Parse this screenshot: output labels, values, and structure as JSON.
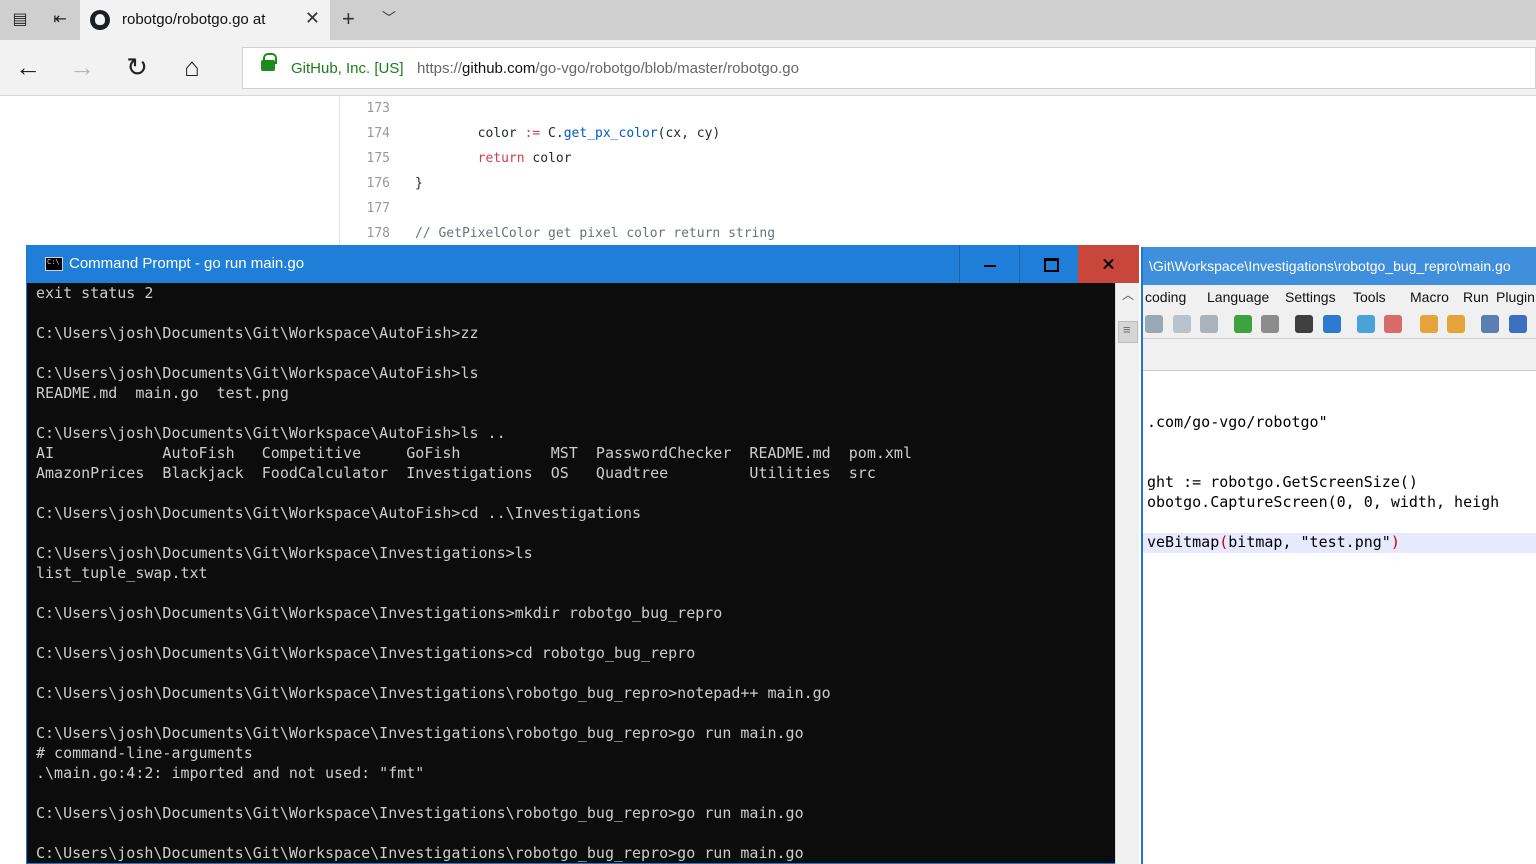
{
  "browser": {
    "tab": {
      "title": "robotgo/robotgo.go at"
    },
    "address": {
      "cert": "GitHub, Inc. [US]",
      "url_scheme": "https://",
      "url_host": "github.com",
      "url_path": "/go-vgo/robotgo/blob/master/robotgo.go"
    }
  },
  "github_code": {
    "lines": [
      {
        "num": "173",
        "parts": []
      },
      {
        "num": "174",
        "parts": [
          {
            "t": "        color ",
            "c": ""
          },
          {
            "t": ":=",
            "c": "kw"
          },
          {
            "t": " C.",
            "c": ""
          },
          {
            "t": "get_px_color",
            "c": "fn"
          },
          {
            "t": "(cx, cy)",
            "c": ""
          }
        ]
      },
      {
        "num": "175",
        "parts": [
          {
            "t": "        ",
            "c": ""
          },
          {
            "t": "return",
            "c": "kw"
          },
          {
            "t": " color",
            "c": ""
          }
        ]
      },
      {
        "num": "176",
        "parts": [
          {
            "t": "}",
            "c": ""
          }
        ]
      },
      {
        "num": "177",
        "parts": []
      },
      {
        "num": "178",
        "parts": [
          {
            "t": "// GetPixelColor get pixel color return string",
            "c": "cm"
          }
        ]
      }
    ]
  },
  "notepadpp": {
    "title": "\\Git\\Workspace\\Investigations\\robotgo_bug_repro\\main.go",
    "menu": [
      "coding",
      "Language",
      "Settings",
      "Tools",
      "Macro",
      "Run",
      "Plugin"
    ],
    "lines": [
      {
        "text": ".com/go-vgo/robotgo\"",
        "row": 0
      },
      {
        "text": "ght := robotgo.GetScreenSize()",
        "row": 3
      },
      {
        "text": "obotgo.CaptureScreen(0, 0, width, heigh",
        "row": 4
      },
      {
        "text": "veBitmap",
        "op1": "(",
        "mid": "bitmap, \"test.png\"",
        "op2": ")",
        "row": 6,
        "current": true
      }
    ]
  },
  "cmd": {
    "title": "Command Prompt - go  run main.go",
    "lines": [
      "exit status 2",
      "",
      "C:\\Users\\josh\\Documents\\Git\\Workspace\\AutoFish>zz",
      "",
      "C:\\Users\\josh\\Documents\\Git\\Workspace\\AutoFish>ls",
      "README.md  main.go  test.png",
      "",
      "C:\\Users\\josh\\Documents\\Git\\Workspace\\AutoFish>ls ..",
      "AI            AutoFish   Competitive     GoFish          MST  PasswordChecker  README.md  pom.xml",
      "AmazonPrices  Blackjack  FoodCalculator  Investigations  OS   Quadtree         Utilities  src",
      "",
      "C:\\Users\\josh\\Documents\\Git\\Workspace\\AutoFish>cd ..\\Investigations",
      "",
      "C:\\Users\\josh\\Documents\\Git\\Workspace\\Investigations>ls",
      "list_tuple_swap.txt",
      "",
      "C:\\Users\\josh\\Documents\\Git\\Workspace\\Investigations>mkdir robotgo_bug_repro",
      "",
      "C:\\Users\\josh\\Documents\\Git\\Workspace\\Investigations>cd robotgo_bug_repro",
      "",
      "C:\\Users\\josh\\Documents\\Git\\Workspace\\Investigations\\robotgo_bug_repro>notepad++ main.go",
      "",
      "C:\\Users\\josh\\Documents\\Git\\Workspace\\Investigations\\robotgo_bug_repro>go run main.go",
      "# command-line-arguments",
      ".\\main.go:4:2: imported and not used: \"fmt\"",
      "",
      "C:\\Users\\josh\\Documents\\Git\\Workspace\\Investigations\\robotgo_bug_repro>go run main.go",
      "",
      "C:\\Users\\josh\\Documents\\Git\\Workspace\\Investigations\\robotgo_bug_repro>go run main.go"
    ]
  },
  "icons": {
    "back": "←",
    "forward": "→",
    "refresh": "↻",
    "home": "⌂",
    "close_tab": "✕",
    "new_tab": "+",
    "tab_list": "﹀",
    "scroll_up": "︿"
  }
}
